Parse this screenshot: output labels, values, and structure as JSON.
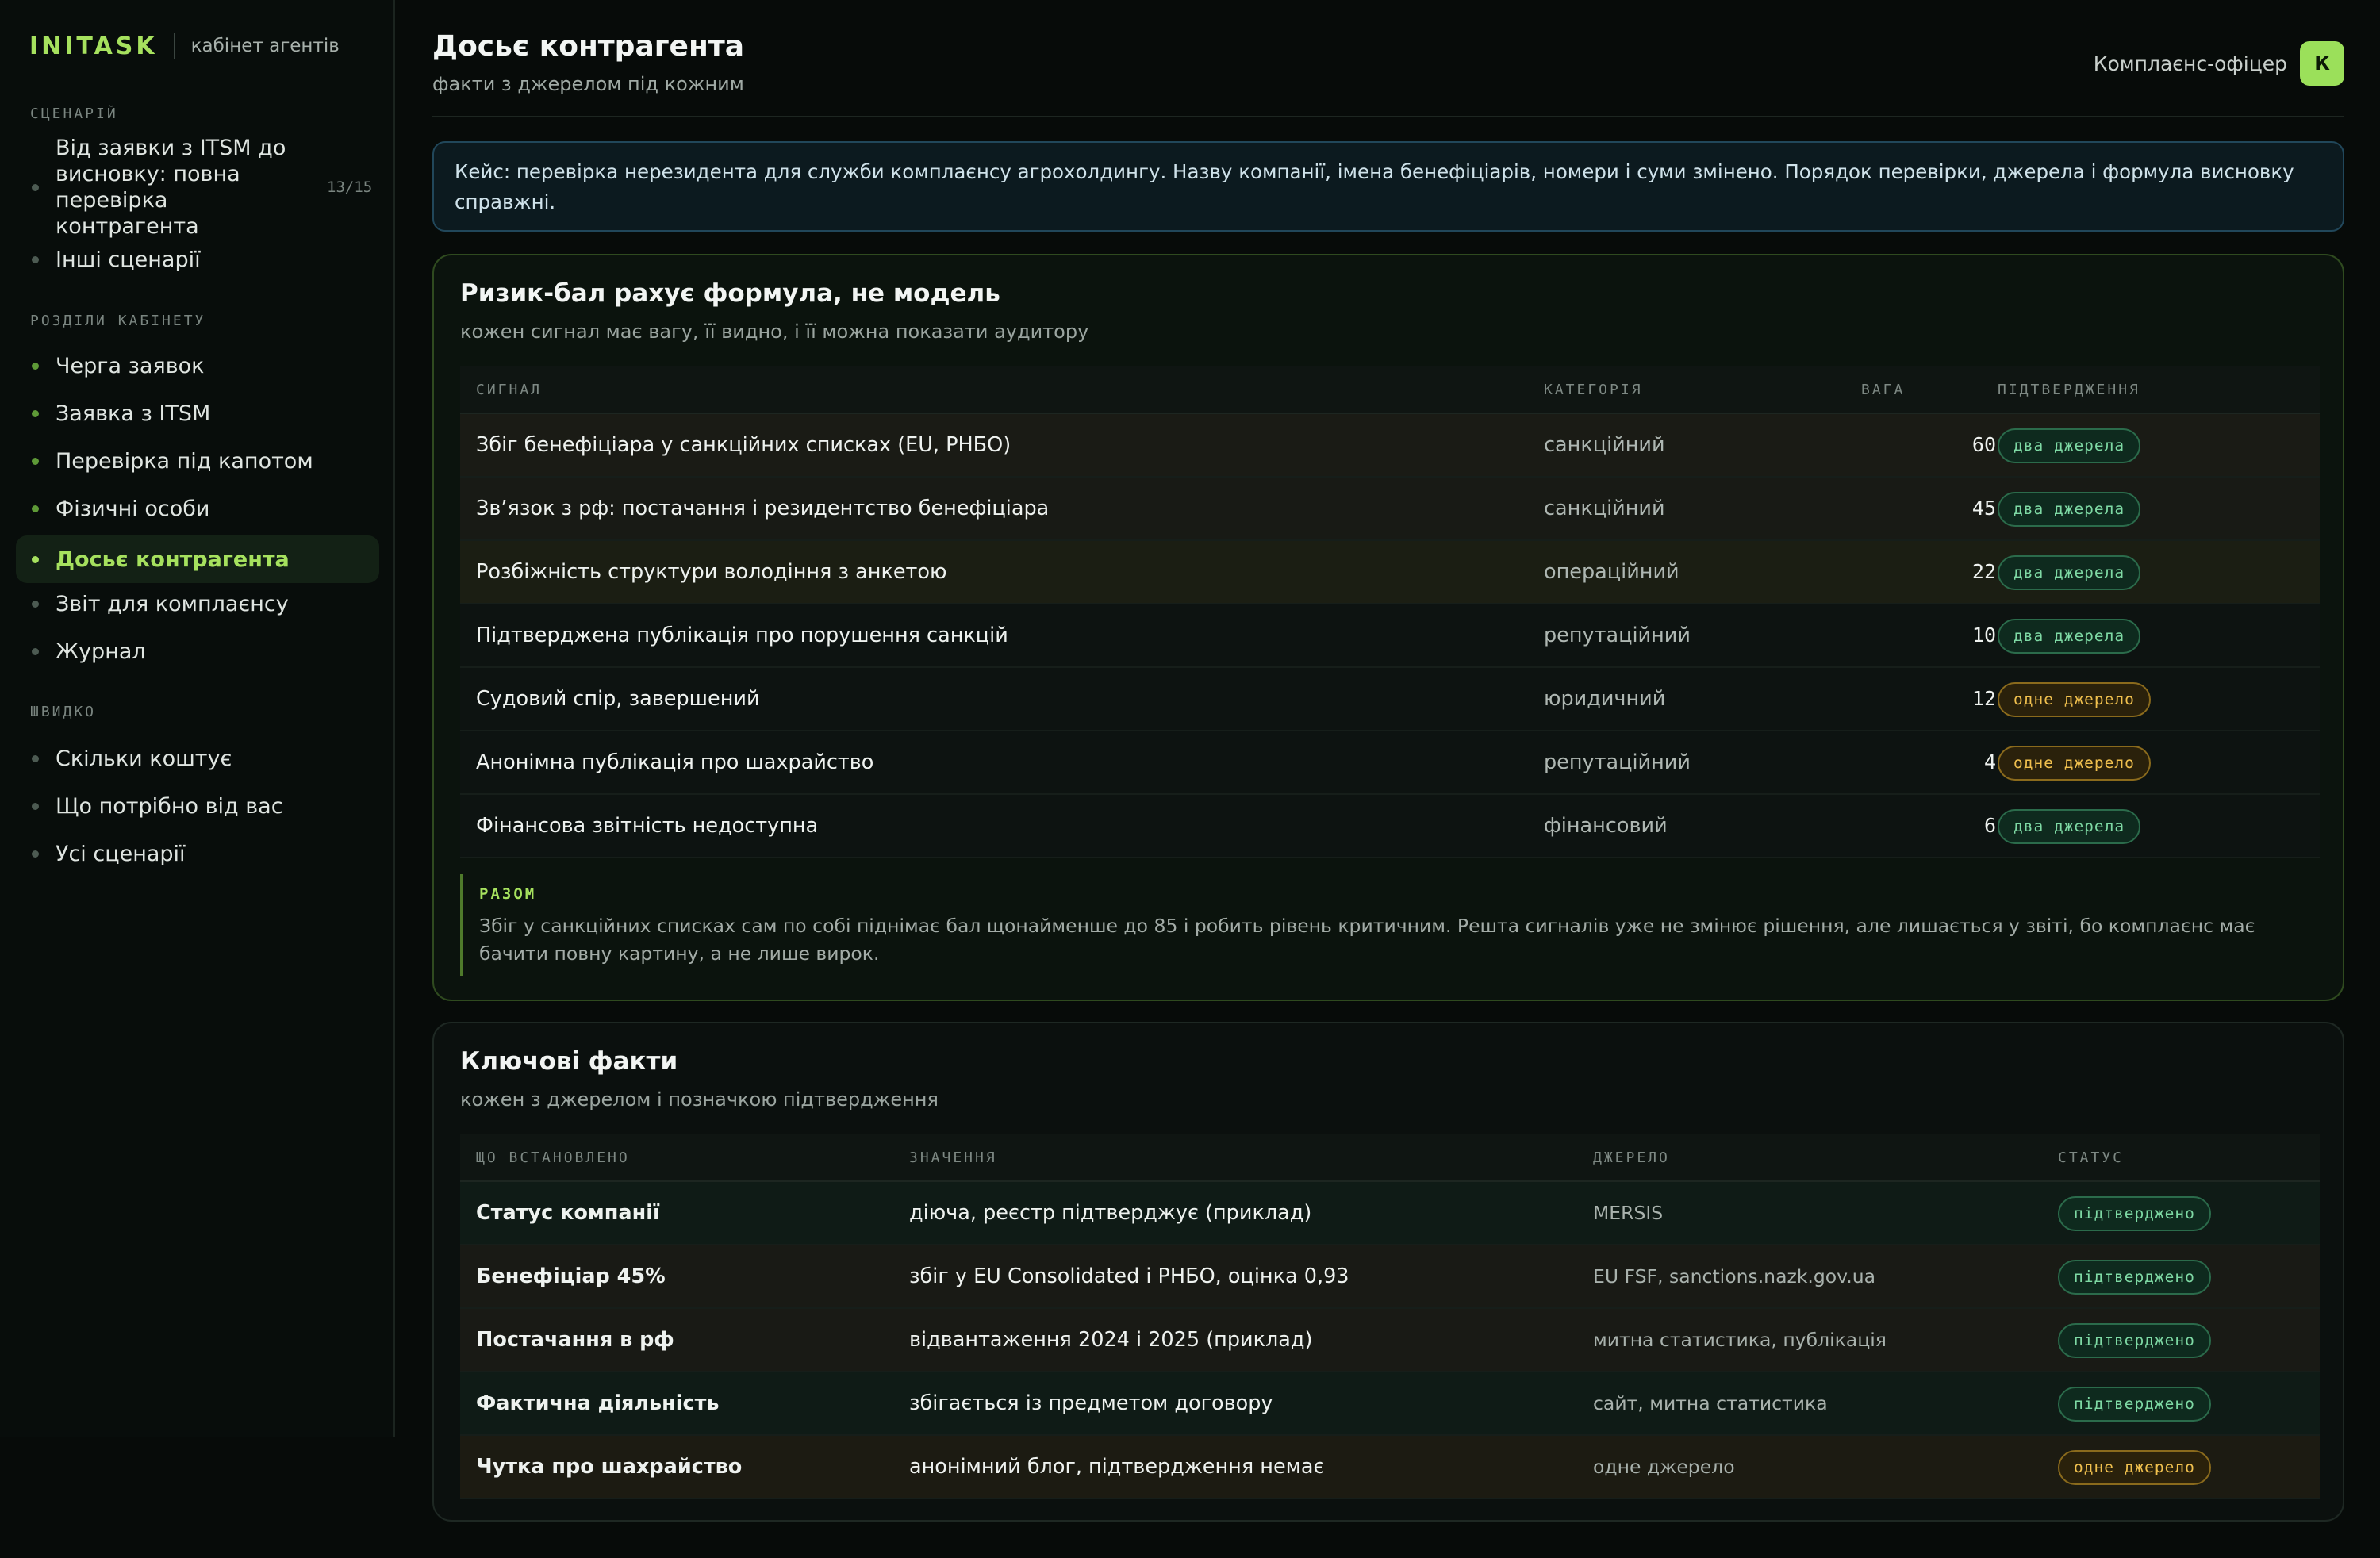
{
  "brand": {
    "logo": "INITASK",
    "subtitle": "кабінет агентів"
  },
  "sidebar": {
    "scenario_label": "СЦЕНАРІЙ",
    "scenario_items": [
      {
        "label": "Від заявки з ITSM до висновку: повна перевірка контрагента",
        "count": "13/15"
      },
      {
        "label": "Інші сценарії"
      }
    ],
    "sections_label": "РОЗДІЛИ КАБІНЕТУ",
    "section_items": [
      {
        "label": "Черга заявок"
      },
      {
        "label": "Заявка з ITSM"
      },
      {
        "label": "Перевірка під капотом"
      },
      {
        "label": "Фізичні особи"
      },
      {
        "label": "Досьє контрагента"
      },
      {
        "label": "Звіт для комплаєнсу"
      },
      {
        "label": "Журнал"
      }
    ],
    "quick_label": "ШВИДКО",
    "quick_items": [
      {
        "label": "Скільки коштує"
      },
      {
        "label": "Що потрібно від вас"
      },
      {
        "label": "Усі сценарії"
      }
    ]
  },
  "header": {
    "title": "Досьє контрагента",
    "subtitle": "факти з джерелом під кожним",
    "user_role": "Комплаєнс-офіцер",
    "avatar_initial": "К"
  },
  "notice": "Кейс: перевірка нерезидента для служби комплаєнсу агрохолдингу. Назву компанії, імена бенефіціарів, номери і суми змінено. Порядок перевірки, джерела і формула висновку справжні.",
  "risk": {
    "title": "Ризик-бал рахує формула, не модель",
    "subtitle": "кожен сигнал має вагу, її видно, і її можна показати аудитору",
    "columns": [
      "СИГНАЛ",
      "КАТЕГОРІЯ",
      "ВАГА",
      "ПІДТВЕРДЖЕННЯ"
    ],
    "rows": [
      {
        "signal": "Збіг бенефіціара у санкційних списках (EU, РНБО)",
        "category": "санкційний",
        "weight": "60",
        "confirmation": "два джерела",
        "level": "ok"
      },
      {
        "signal": "Зв’язок з рф: постачання і резидентство бенефіціара",
        "category": "санкційний",
        "weight": "45",
        "confirmation": "два джерела",
        "level": "ok"
      },
      {
        "signal": "Розбіжність структури володіння з анкетою",
        "category": "операційний",
        "weight": "22",
        "confirmation": "два джерела",
        "level": "ok"
      },
      {
        "signal": "Підтверджена публікація про порушення санкцій",
        "category": "репутаційний",
        "weight": "10",
        "confirmation": "два джерела",
        "level": "ok"
      },
      {
        "signal": "Судовий спір, завершений",
        "category": "юридичний",
        "weight": "12",
        "confirmation": "одне джерело",
        "level": "warn"
      },
      {
        "signal": "Анонімна публікація про шахрайство",
        "category": "репутаційний",
        "weight": "4",
        "confirmation": "одне джерело",
        "level": "warn"
      },
      {
        "signal": "Фінансова звітність недоступна",
        "category": "фінансовий",
        "weight": "6",
        "confirmation": "два джерела",
        "level": "ok"
      }
    ],
    "summary_label": "РАЗОМ",
    "summary_text": "Збіг у санкційних списках сам по собі піднімає бал щонайменше до 85 і робить рівень критичним. Решта сигналів уже не змінює рішення, але лишається у звіті, бо комплаєнс має бачити повну картину, а не лише вирок."
  },
  "facts": {
    "title": "Ключові факти",
    "subtitle": "кожен з джерелом і позначкою підтвердження",
    "columns": [
      "ЩО ВСТАНОВЛЕНО",
      "ЗНАЧЕННЯ",
      "ДЖЕРЕЛО",
      "СТАТУС"
    ],
    "rows": [
      {
        "fact": "Статус компанії",
        "value": "діюча, реєстр підтверджує (приклад)",
        "source": "MERSIS",
        "status": "підтверджено",
        "level": "ok"
      },
      {
        "fact": "Бенефіціар 45%",
        "value": "збіг у EU Consolidated і РНБО, оцінка 0,93",
        "source": "EU FSF, sanctions.nazk.gov.ua",
        "status": "підтверджено",
        "level": "ok"
      },
      {
        "fact": "Постачання в рф",
        "value": "відвантаження 2024 і 2025 (приклад)",
        "source": "митна статистика, публікація",
        "status": "підтверджено",
        "level": "ok"
      },
      {
        "fact": "Фактична діяльність",
        "value": "збігається із предметом договору",
        "source": "сайт, митна статистика",
        "status": "підтверджено",
        "level": "ok"
      },
      {
        "fact": "Чутка про шахрайство",
        "value": "анонімний блог, підтвердження немає",
        "source": "одне джерело",
        "status": "одне джерело",
        "level": "warn"
      }
    ]
  },
  "colors": {
    "accent": "#a6e15e",
    "ok": "#7ed9a4",
    "warn": "#f0c04e",
    "row_tints": [
      "#1a1b15",
      "#181a15",
      "#1b1e13",
      "#0d1311",
      "#0d1311",
      "#0d1311",
      "#0d1311"
    ],
    "fact_tints": [
      "#0f1b16",
      "#191a15",
      "#191a15",
      "#0f1b16",
      "#1c1b12"
    ]
  }
}
